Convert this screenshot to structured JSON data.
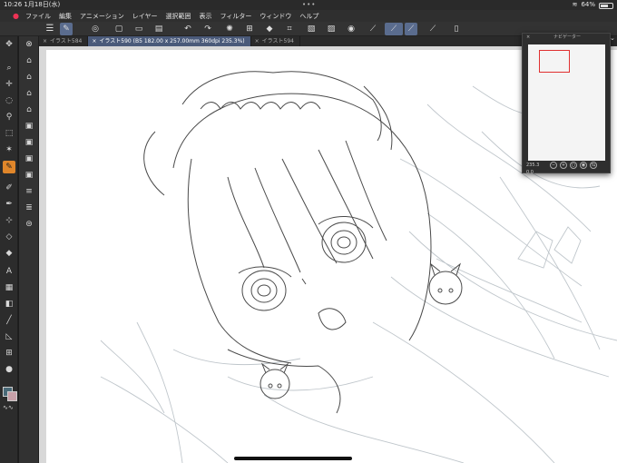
{
  "status": {
    "time": "10:26",
    "date": "1月18日(水)",
    "dots": "•••",
    "battery": "64%"
  },
  "menu": [
    "ファイル",
    "編集",
    "アニメーション",
    "レイヤー",
    "選択範囲",
    "表示",
    "フィルター",
    "ウィンドウ",
    "ヘルプ"
  ],
  "tabs": [
    {
      "label": "イラスト584",
      "active": false
    },
    {
      "label": "イラスト590 (B5 182.00 x 257.00mm 360dpi 235.3%)",
      "active": true
    },
    {
      "label": "イラスト594",
      "active": false
    }
  ],
  "tab_close": "×",
  "navigator": {
    "title": "ナビゲーター",
    "close": "×",
    "zoom": "235.3",
    "angle": "0.0"
  },
  "colors": {
    "main": "#4a6a78",
    "sub": "#c7a0a8",
    "accent": "#e0862a",
    "active_tab": "#4a5a7a"
  },
  "toolbar_icons": [
    "menu-icon",
    "pen-mode-icon",
    "layer-icon",
    "new-icon",
    "open-icon",
    "save-icon",
    "undo-icon",
    "redo-icon",
    "spinner-icon",
    "transform-icon",
    "fill-icon",
    "crop-icon",
    "select-icon",
    "invert-icon",
    "deselect-icon",
    "ruler-icon",
    "pen-icon",
    "pencil-icon",
    "pencil-alt-icon",
    "phone-icon"
  ],
  "tool_icons": [
    "cursor-icon",
    "zoom-icon",
    "move-icon",
    "lasso-icon",
    "eyedropper-icon",
    "select-tool-icon",
    "magic-wand-icon",
    "pen-tool-icon",
    "pencil-tool-icon",
    "brush-icon",
    "airbrush-icon",
    "eraser-icon",
    "text-icon",
    "gradient-icon",
    "fill-tool-icon",
    "line-icon",
    "frame-icon",
    "figure-icon",
    "shape-icon",
    "blend-icon"
  ]
}
